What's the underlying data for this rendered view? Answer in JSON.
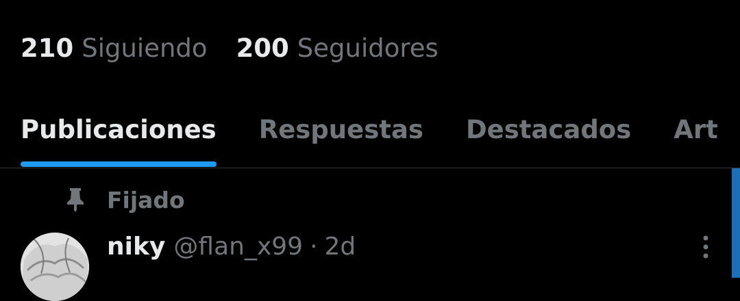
{
  "profile": {
    "following_count": "210",
    "following_label": "Siguiendo",
    "followers_count": "200",
    "followers_label": "Seguidores"
  },
  "tabs": [
    {
      "label": "Publicaciones",
      "active": true
    },
    {
      "label": "Respuestas",
      "active": false
    },
    {
      "label": "Destacados",
      "active": false
    },
    {
      "label": "Art",
      "active": false
    }
  ],
  "pinned": {
    "label": "Fijado",
    "icon": "pin-icon"
  },
  "post": {
    "author_name": "niky",
    "handle": "@flan_x99",
    "separator": "·",
    "time": "2d",
    "more_icon": "more-vertical-icon"
  },
  "colors": {
    "background": "#000000",
    "primary_text": "#e7e9ea",
    "secondary_text": "#71767b",
    "accent": "#1d9bf0",
    "divider": "#2f3336"
  }
}
